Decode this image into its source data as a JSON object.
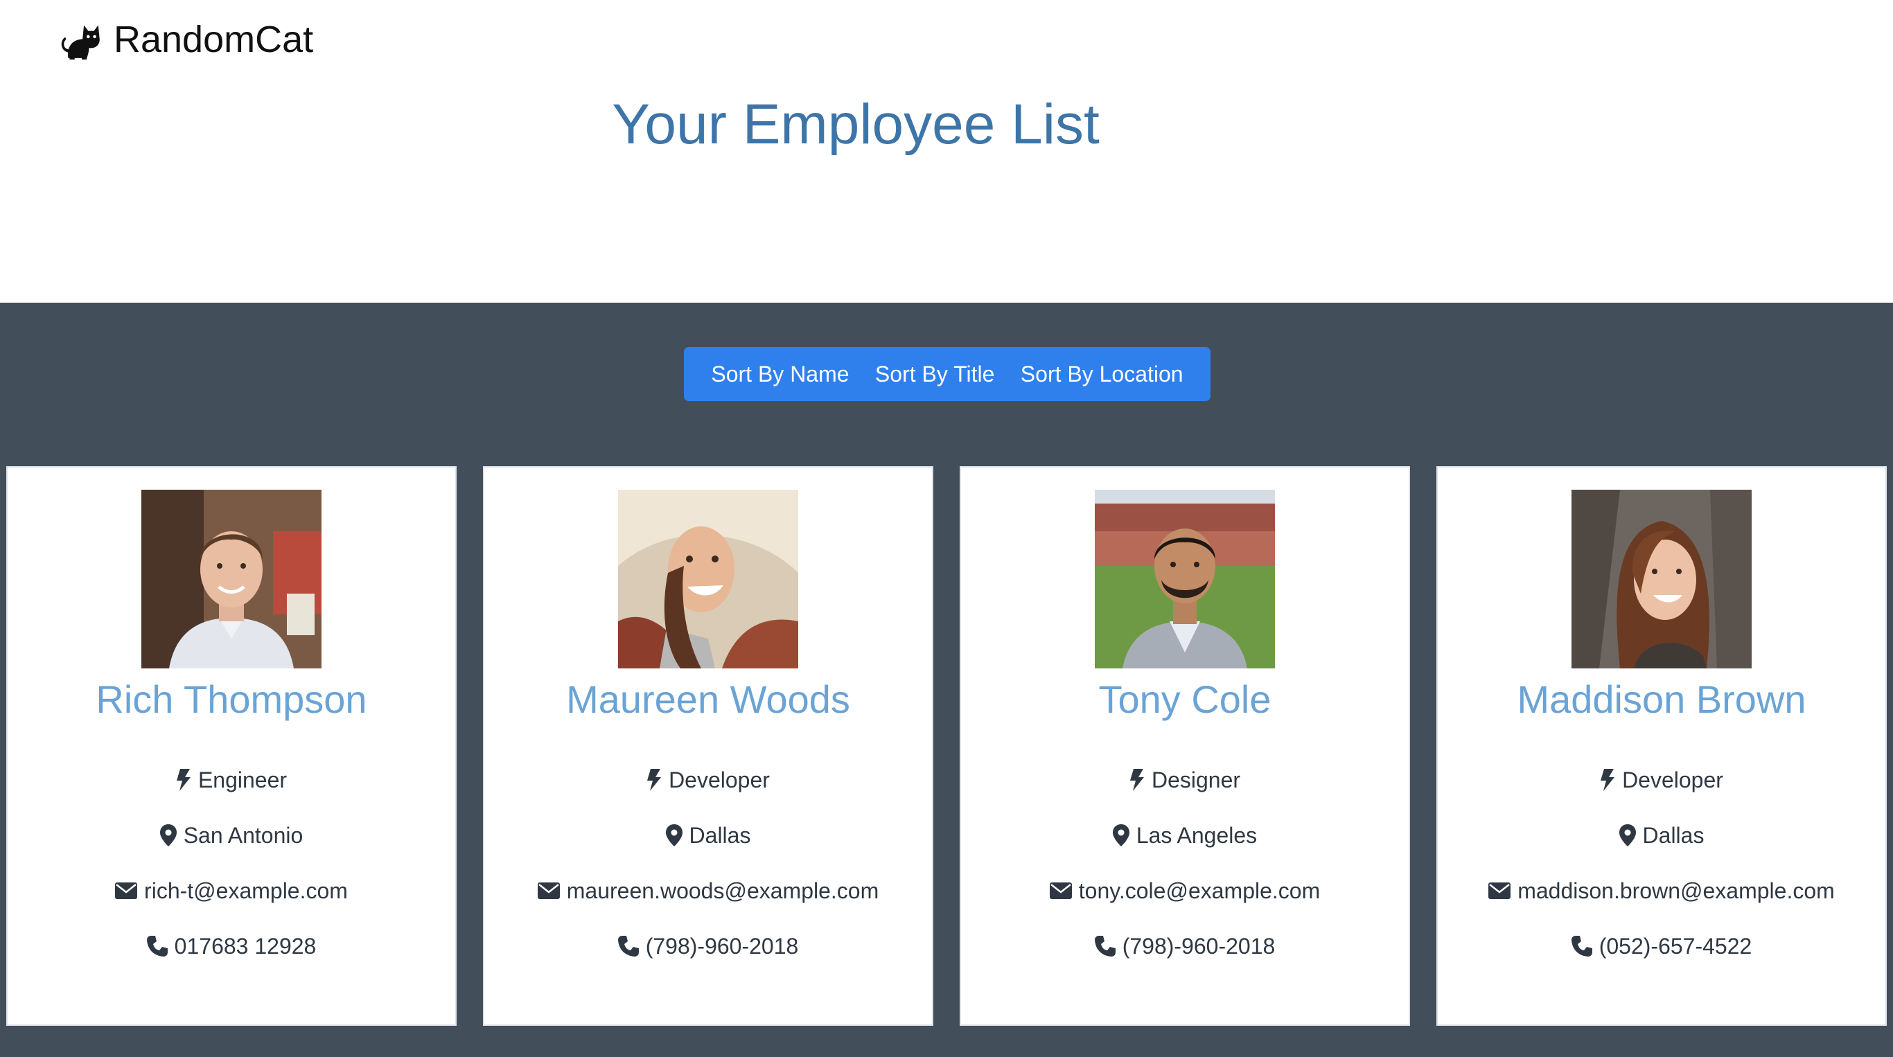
{
  "brand": {
    "name": "RandomCat",
    "icon": "cat-icon"
  },
  "page_title": "Your Employee List",
  "sort_buttons": [
    {
      "label": "Sort By Name"
    },
    {
      "label": "Sort By Title"
    },
    {
      "label": "Sort By Location"
    }
  ],
  "colors": {
    "title_blue": "#3d75a8",
    "name_blue": "#6aa3d5",
    "dark_bg": "#434e5b",
    "button_blue": "#2f80ed"
  },
  "employees": [
    {
      "name": "Rich Thompson",
      "title": "Engineer",
      "location": "San Antonio",
      "email": "rich-t@example.com",
      "phone": "017683 12928",
      "photo": "employee-photo"
    },
    {
      "name": "Maureen Woods",
      "title": "Developer",
      "location": "Dallas",
      "email": "maureen.woods@example.com",
      "phone": "(798)-960-2018",
      "photo": "employee-photo"
    },
    {
      "name": "Tony Cole",
      "title": "Designer",
      "location": "Las Angeles",
      "email": "tony.cole@example.com",
      "phone": "(798)-960-2018",
      "photo": "employee-photo"
    },
    {
      "name": "Maddison Brown",
      "title": "Developer",
      "location": "Dallas",
      "email": "maddison.brown@example.com",
      "phone": "(052)-657-4522",
      "photo": "employee-photo"
    }
  ]
}
